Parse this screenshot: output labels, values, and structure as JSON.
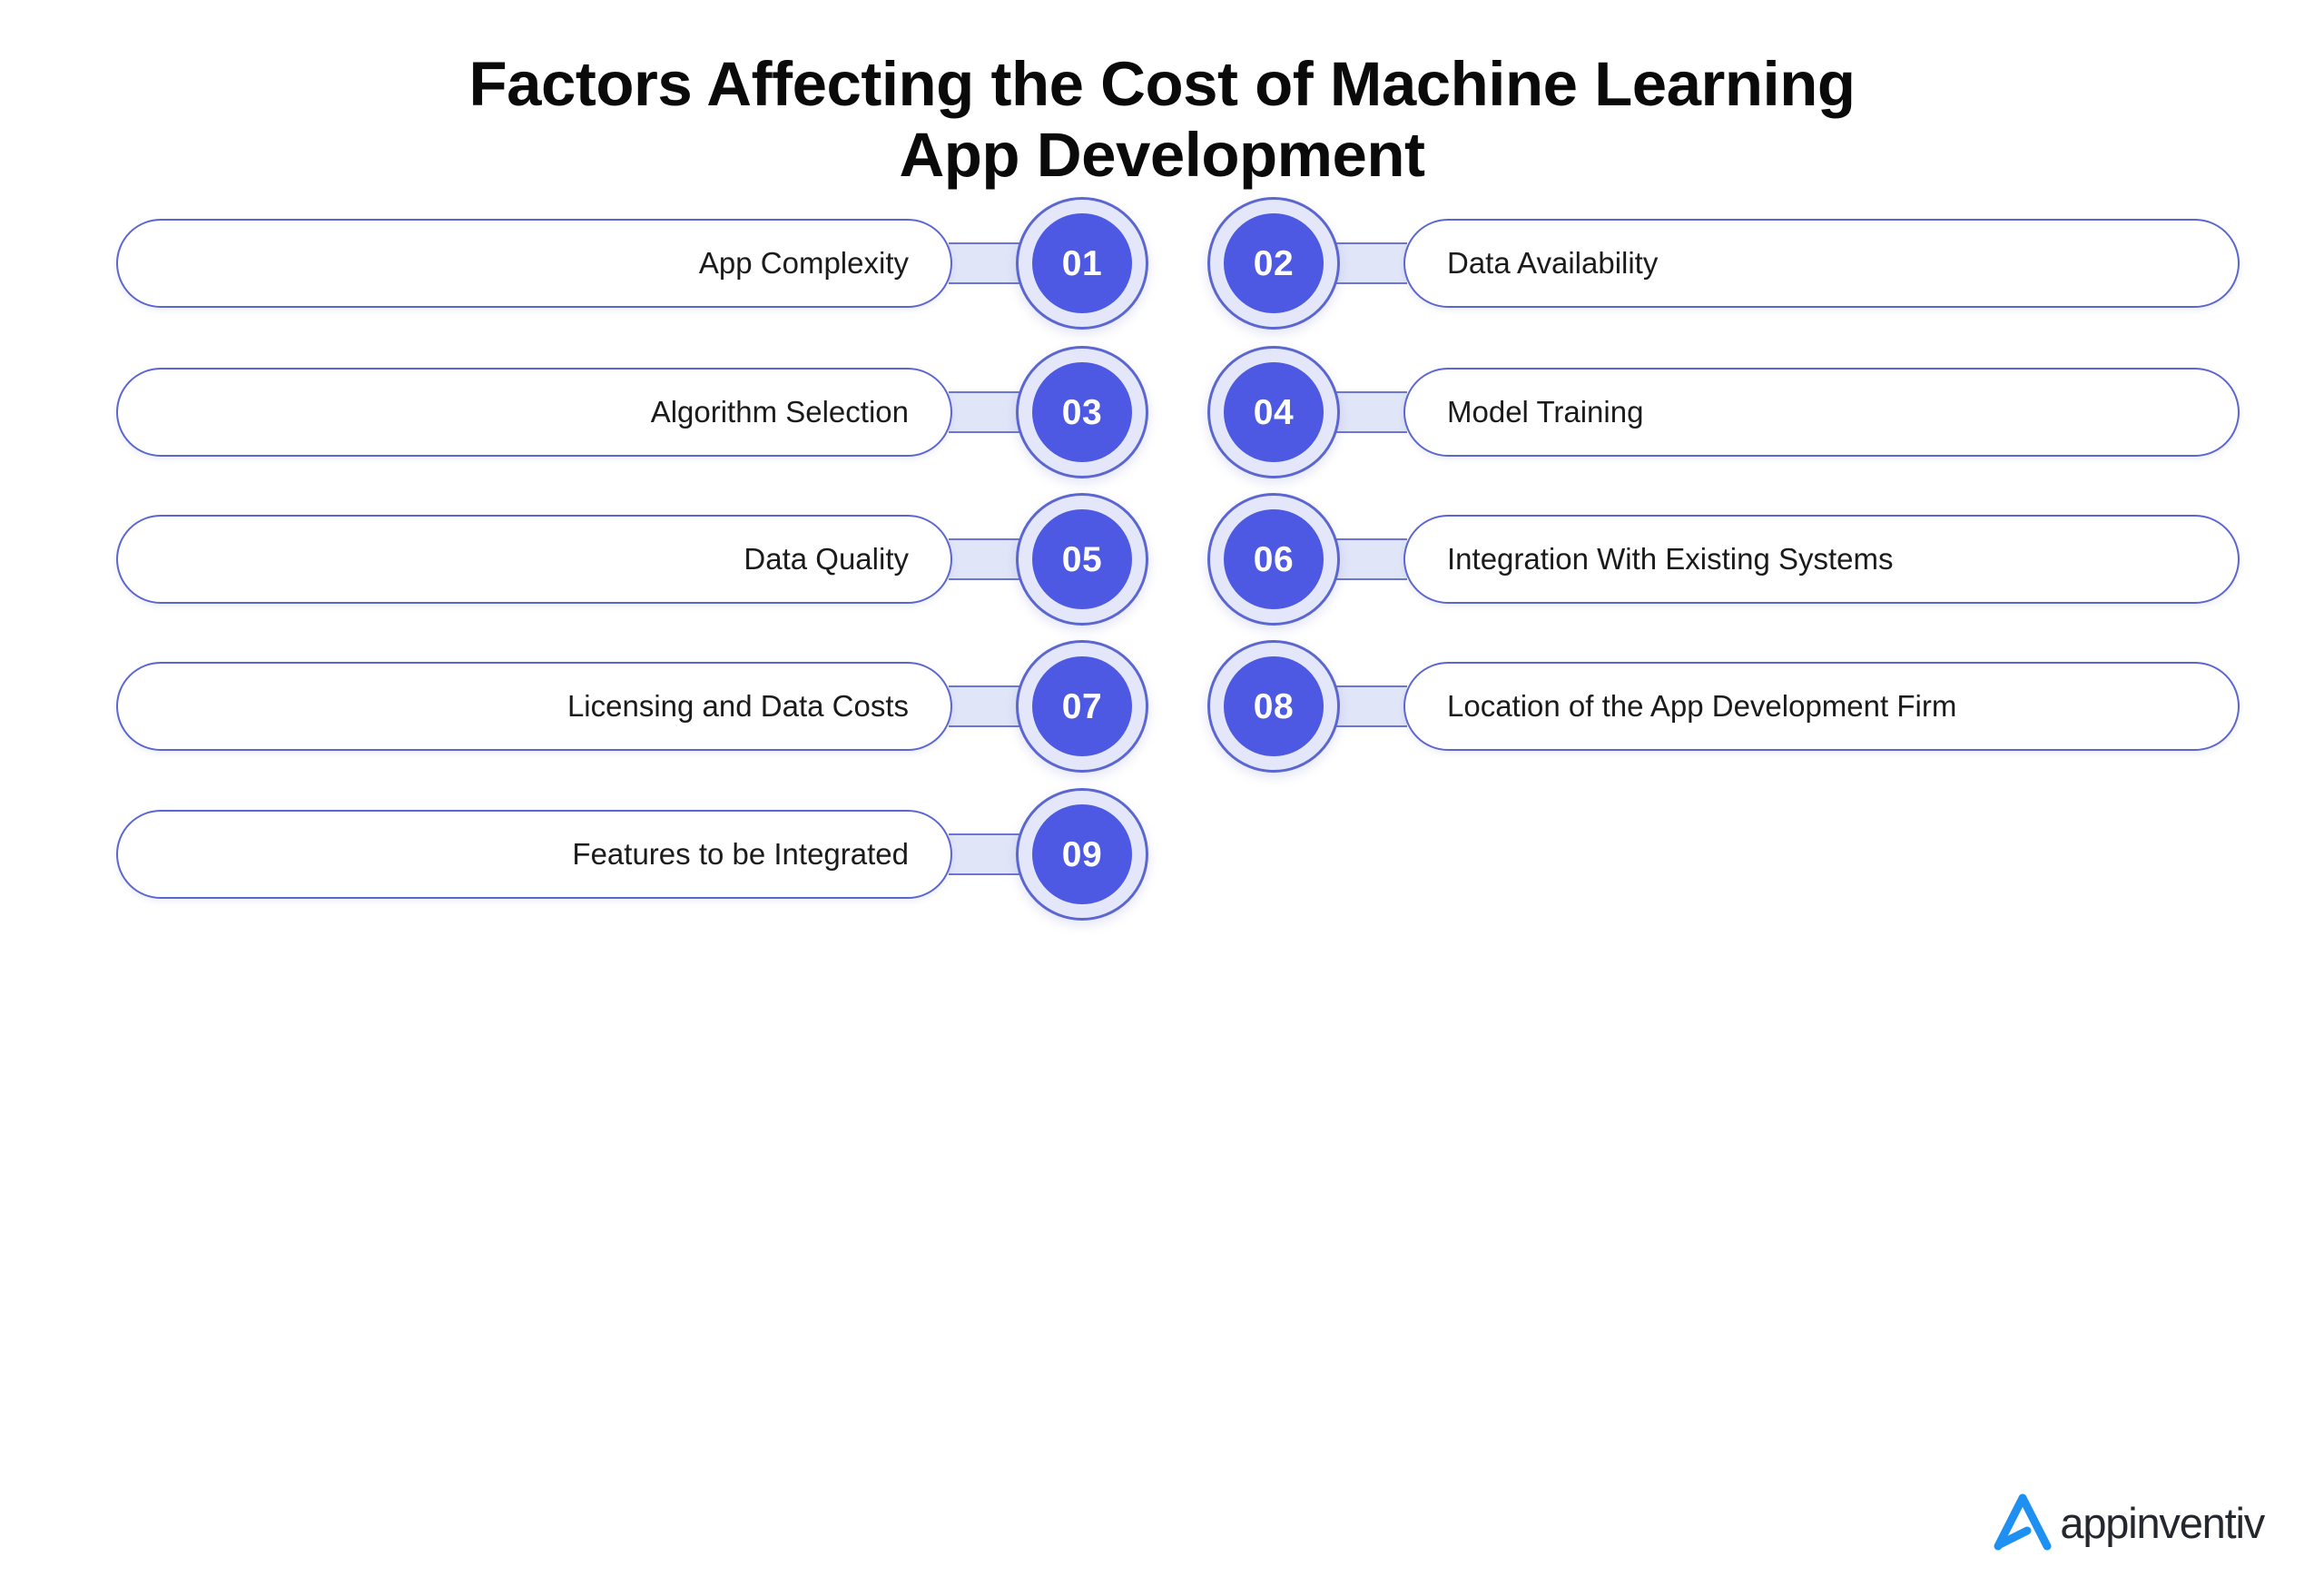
{
  "title": {
    "line1": "Factors Affecting the Cost of Machine Learning",
    "line2": "App Development"
  },
  "colors": {
    "background": "#ffffff",
    "accent_blue": "#4d59e2",
    "badge_ring": "#e3e7f9",
    "border_blue": "#5b66d1",
    "connector_fill": "#e1e5f8",
    "title_text": "#0a0a0a",
    "label_text": "#1b1b1b",
    "logo_mark": "#1e90f2",
    "logo_text": "#24282e"
  },
  "rows": [
    {
      "left": {
        "number": "01",
        "label": "App Complexity"
      },
      "right": {
        "number": "02",
        "label": "Data Availability"
      }
    },
    {
      "left": {
        "number": "03",
        "label": "Algorithm Selection"
      },
      "right": {
        "number": "04",
        "label": "Model Training"
      }
    },
    {
      "left": {
        "number": "05",
        "label": "Data Quality"
      },
      "right": {
        "number": "06",
        "label": "Integration With Existing Systems"
      }
    },
    {
      "left": {
        "number": "07",
        "label": "Licensing and Data Costs"
      },
      "right": {
        "number": "08",
        "label": "Location of the App Development Firm"
      }
    },
    {
      "left": {
        "number": "09",
        "label": "Features to be Integrated"
      },
      "right": null
    }
  ],
  "logo": {
    "name": "appinventiv",
    "mark": "appinventiv-a-mark"
  }
}
